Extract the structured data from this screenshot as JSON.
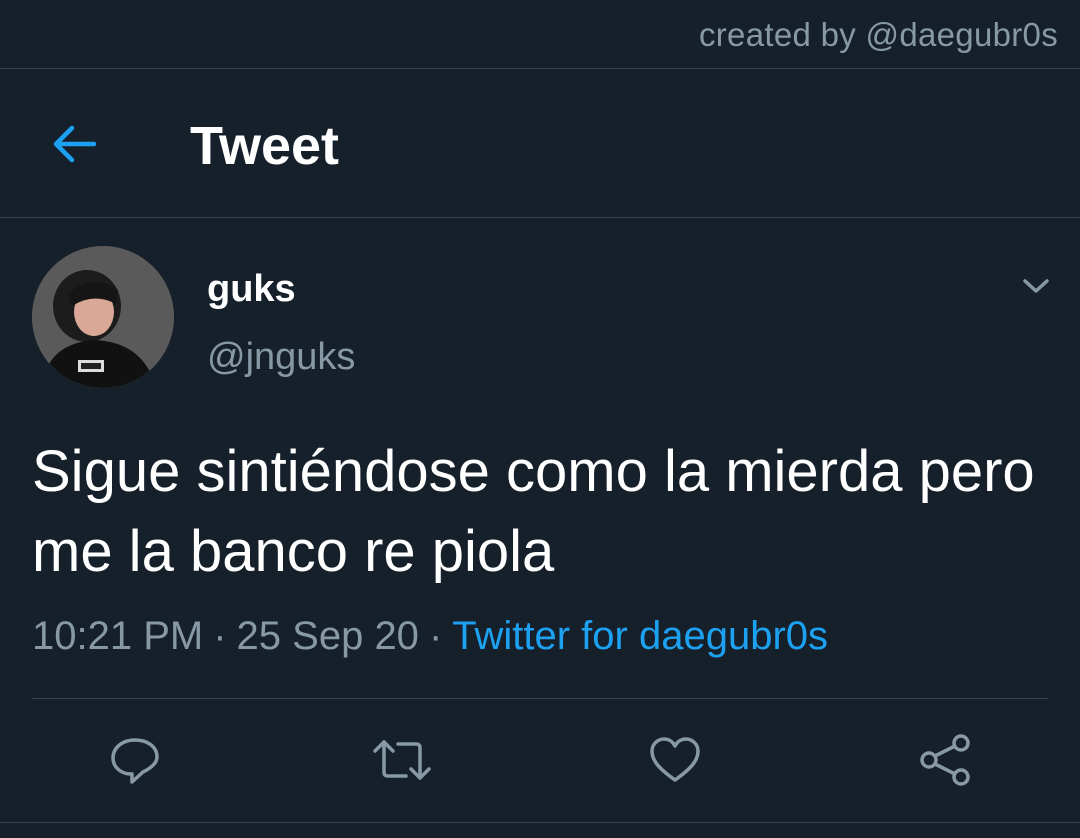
{
  "credit": "created by @daegubr0s",
  "header": {
    "title": "Tweet",
    "back_icon": "arrow-left-icon"
  },
  "tweet": {
    "display_name": "guks",
    "handle": "@jnguks",
    "text": "Sigue sintiéndose como la mierda pero me la banco re piola",
    "time": "10:21 PM",
    "date": "25 Sep 20",
    "separator": "·",
    "client": "Twitter for daegubr0s"
  },
  "actions": {
    "icons": [
      "reply-icon",
      "retweet-icon",
      "like-icon",
      "share-icon"
    ]
  },
  "colors": {
    "background": "#15202b",
    "accent": "#1da1f2",
    "muted": "#8899a6",
    "divider": "#38444d"
  }
}
